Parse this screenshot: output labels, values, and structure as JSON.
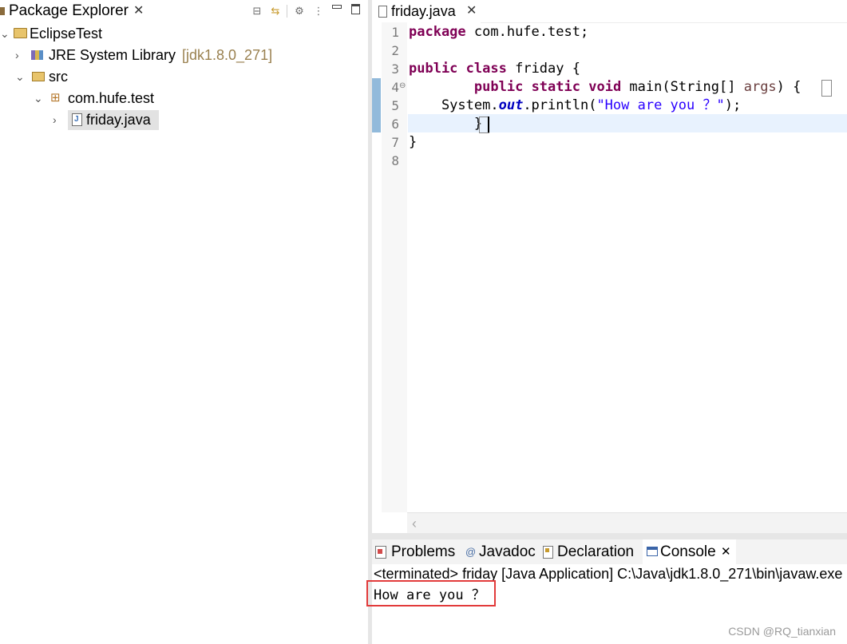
{
  "explorer": {
    "tab_title": "Package Explorer",
    "tree": {
      "project": "EclipseTest",
      "jre_label": "JRE System Library",
      "jre_version": "[jdk1.8.0_271]",
      "src": "src",
      "package": "com.hufe.test",
      "file": "friday.java"
    }
  },
  "editor": {
    "tab_title": "friday.java",
    "line_numbers": [
      "1",
      "2",
      "3",
      "4",
      "5",
      "6",
      "7",
      "8"
    ],
    "code": {
      "l1_kw": "package",
      "l1_rest": " com.hufe.test;",
      "l3_kw1": "public",
      "l3_kw2": "class",
      "l3_rest": " friday {",
      "l4_indent": "        ",
      "l4_kw1": "public",
      "l4_kw2": "static",
      "l4_kw3": "void",
      "l4_mid": " main(String[] ",
      "l4_param": "args",
      "l4_end": ") {",
      "l5_a": "    System.",
      "l5_field": "out",
      "l5_b": ".println(",
      "l5_str": "\"How are you ？\"",
      "l5_c": ");",
      "l6": "        }",
      "l7": "}"
    }
  },
  "console": {
    "tabs": [
      {
        "label": "Problems",
        "icon": "problems-icon"
      },
      {
        "label": "Javadoc",
        "icon": "at-icon"
      },
      {
        "label": "Declaration",
        "icon": "declaration-icon"
      },
      {
        "label": "Console",
        "icon": "console-icon"
      }
    ],
    "status": "<terminated> friday [Java Application] C:\\Java\\jdk1.8.0_271\\bin\\javaw.exe",
    "output": "How are you ？"
  },
  "watermark": "CSDN @RQ_tianxian",
  "colors": {
    "keyword": "#7f0055",
    "string": "#2a00ff",
    "field": "#0000c0",
    "highlight_border": "#e23b3b"
  }
}
